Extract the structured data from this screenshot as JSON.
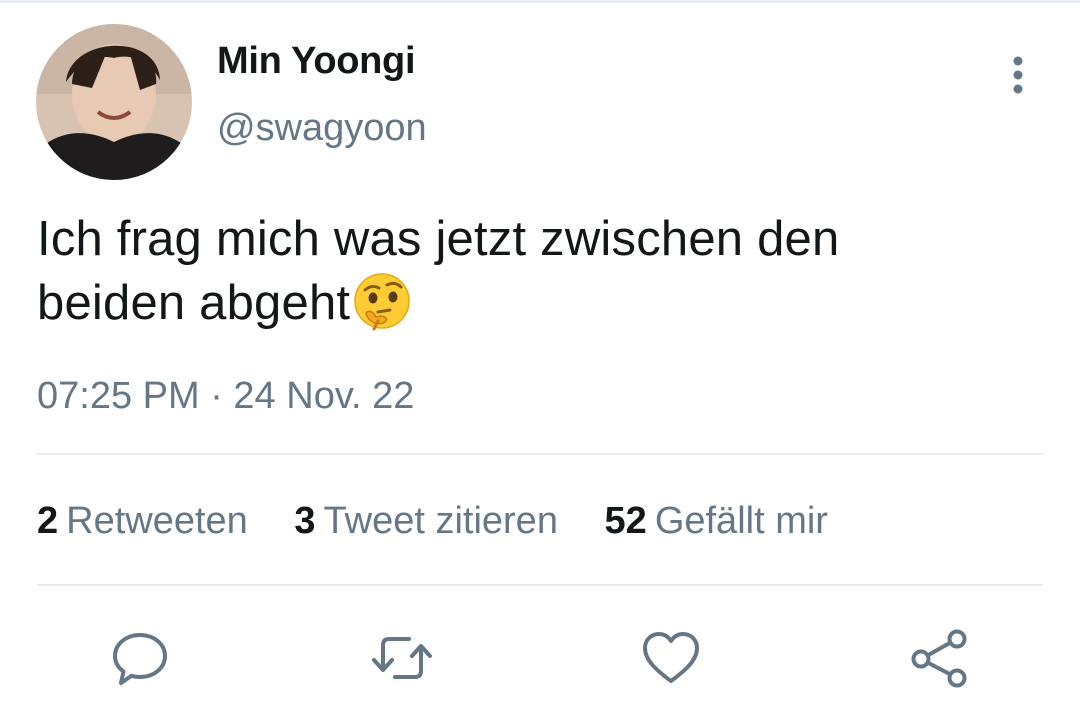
{
  "tweet": {
    "author": {
      "display_name": "Min Yoongi",
      "handle": "@swagyoon"
    },
    "text_line_1": "Ich frag mich was jetzt zwischen den",
    "text_line_2": "beiden abgeht",
    "emoji": "thinking-face",
    "timestamp": "07:25 PM · 24 Nov. 22"
  },
  "stats": {
    "retweets": {
      "count": "2",
      "label": "Retweeten"
    },
    "quotes": {
      "count": "3",
      "label": "Tweet zitieren"
    },
    "likes": {
      "count": "52",
      "label": "Gefällt mir"
    }
  },
  "actions": {
    "reply_icon": "comment-icon",
    "retweet_icon": "retweet-icon",
    "like_icon": "heart-icon",
    "share_icon": "share-icon"
  },
  "colors": {
    "text": "#14171a",
    "secondary": "#657786",
    "divider": "#e6ecf0",
    "action_icon": "#657786"
  }
}
